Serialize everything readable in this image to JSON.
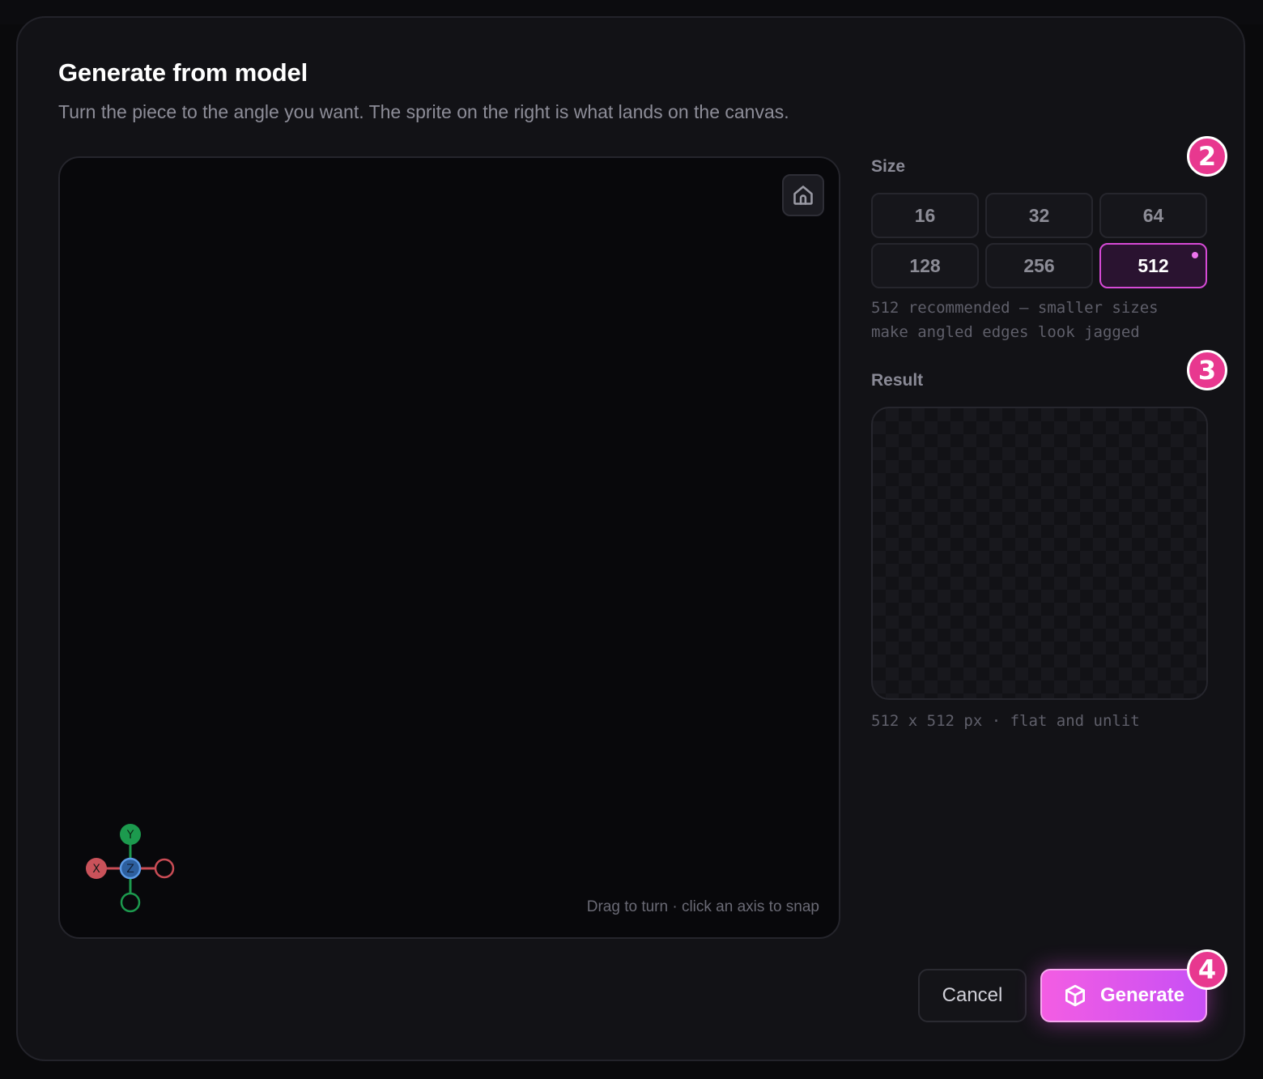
{
  "dialog": {
    "title": "Generate from model",
    "subtitle": "Turn the piece to the angle you want. The sprite on the right is what lands on the canvas."
  },
  "viewport": {
    "hint": "Drag to turn · click an axis to snap",
    "home_icon": "home-icon",
    "gizmo": {
      "x_label": "X",
      "y_label": "Y",
      "z_label": "Z"
    }
  },
  "size": {
    "label": "Size",
    "options": [
      "16",
      "32",
      "64",
      "128",
      "256",
      "512"
    ],
    "selected": "512",
    "note_line1": "512 recommended — smaller sizes",
    "note_line2": "make angled edges look jagged"
  },
  "result": {
    "label": "Result",
    "info": "512 x 512 px · flat and unlit"
  },
  "steps": {
    "size": "2",
    "result": "3",
    "generate": "4"
  },
  "footer": {
    "cancel_label": "Cancel",
    "generate_label": "Generate",
    "generate_icon": "cube-icon"
  },
  "colors": {
    "accent": "#e04fe6",
    "badge": "#e8388f",
    "axis_x": "#d8565e",
    "axis_y": "#1fa355",
    "axis_z": "#4a8fe0"
  }
}
